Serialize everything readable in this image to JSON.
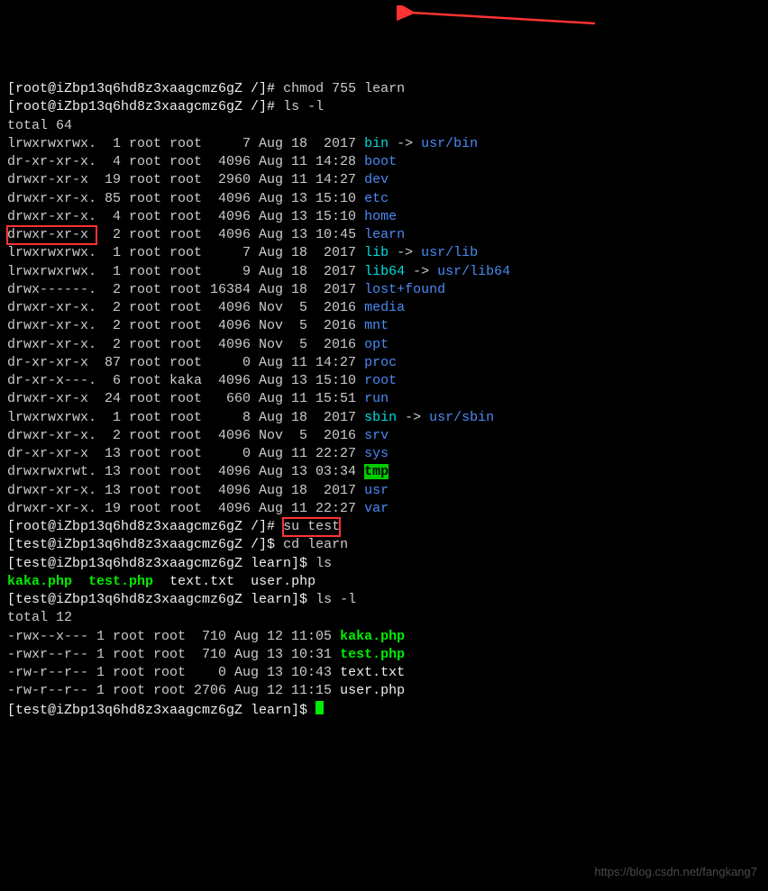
{
  "prompt_root": "[root@iZbp13q6hd8z3xaagcmz6gZ /]# ",
  "prompt_test": "[test@iZbp13q6hd8z3xaagcmz6gZ /]$ ",
  "prompt_test_learn": "[test@iZbp13q6hd8z3xaagcmz6gZ learn]$ ",
  "cmd_chmod": "chmod 755 learn",
  "cmd_lsl": "ls -l",
  "cmd_su": "su test",
  "cmd_cd": "cd learn",
  "cmd_ls": "ls",
  "total1": "total 64",
  "total2": "total 12",
  "arrow_link": " -> ",
  "files1": [
    {
      "perm": "lrwxrwxrwx.",
      "links": "1",
      "user": "root",
      "group": "root",
      "size": "7",
      "date": "Aug 18  2017",
      "name": "bin",
      "target": "usr/bin",
      "cls": "cyan"
    },
    {
      "perm": "dr-xr-xr-x.",
      "links": "4",
      "user": "root",
      "group": "root",
      "size": "4096",
      "date": "Aug 11 14:28",
      "name": "boot",
      "cls": "blue"
    },
    {
      "perm": "drwxr-xr-x ",
      "links": "19",
      "user": "root",
      "group": "root",
      "size": "2960",
      "date": "Aug 11 14:27",
      "name": "dev",
      "cls": "blue"
    },
    {
      "perm": "drwxr-xr-x.",
      "links": "85",
      "user": "root",
      "group": "root",
      "size": "4096",
      "date": "Aug 13 15:10",
      "name": "etc",
      "cls": "blue"
    },
    {
      "perm": "drwxr-xr-x.",
      "links": "4",
      "user": "root",
      "group": "root",
      "size": "4096",
      "date": "Aug 13 15:10",
      "name": "home",
      "cls": "blue"
    },
    {
      "perm": "drwxr-xr-x ",
      "links": "2",
      "user": "root",
      "group": "root",
      "size": "4096",
      "date": "Aug 13 10:45",
      "name": "learn",
      "cls": "blue",
      "boxperm": true
    },
    {
      "perm": "lrwxrwxrwx.",
      "links": "1",
      "user": "root",
      "group": "root",
      "size": "7",
      "date": "Aug 18  2017",
      "name": "lib",
      "target": "usr/lib",
      "cls": "cyan"
    },
    {
      "perm": "lrwxrwxrwx.",
      "links": "1",
      "user": "root",
      "group": "root",
      "size": "9",
      "date": "Aug 18  2017",
      "name": "lib64",
      "target": "usr/lib64",
      "cls": "cyan"
    },
    {
      "perm": "drwx------.",
      "links": "2",
      "user": "root",
      "group": "root",
      "size": "16384",
      "date": "Aug 18  2017",
      "name": "lost+found",
      "cls": "blue"
    },
    {
      "perm": "drwxr-xr-x.",
      "links": "2",
      "user": "root",
      "group": "root",
      "size": "4096",
      "date": "Nov  5  2016",
      "name": "media",
      "cls": "blue"
    },
    {
      "perm": "drwxr-xr-x.",
      "links": "2",
      "user": "root",
      "group": "root",
      "size": "4096",
      "date": "Nov  5  2016",
      "name": "mnt",
      "cls": "blue"
    },
    {
      "perm": "drwxr-xr-x.",
      "links": "2",
      "user": "root",
      "group": "root",
      "size": "4096",
      "date": "Nov  5  2016",
      "name": "opt",
      "cls": "blue"
    },
    {
      "perm": "dr-xr-xr-x ",
      "links": "87",
      "user": "root",
      "group": "root",
      "size": "0",
      "date": "Aug 11 14:27",
      "name": "proc",
      "cls": "blue"
    },
    {
      "perm": "dr-xr-x---.",
      "links": "6",
      "user": "root",
      "group": "kaka",
      "size": "4096",
      "date": "Aug 13 15:10",
      "name": "root",
      "cls": "blue"
    },
    {
      "perm": "drwxr-xr-x ",
      "links": "24",
      "user": "root",
      "group": "root",
      "size": "660",
      "date": "Aug 11 15:51",
      "name": "run",
      "cls": "blue"
    },
    {
      "perm": "lrwxrwxrwx.",
      "links": "1",
      "user": "root",
      "group": "root",
      "size": "8",
      "date": "Aug 18  2017",
      "name": "sbin",
      "target": "usr/sbin",
      "cls": "cyan"
    },
    {
      "perm": "drwxr-xr-x.",
      "links": "2",
      "user": "root",
      "group": "root",
      "size": "4096",
      "date": "Nov  5  2016",
      "name": "srv",
      "cls": "blue"
    },
    {
      "perm": "dr-xr-xr-x ",
      "links": "13",
      "user": "root",
      "group": "root",
      "size": "0",
      "date": "Aug 11 22:27",
      "name": "sys",
      "cls": "blue"
    },
    {
      "perm": "drwxrwxrwt.",
      "links": "13",
      "user": "root",
      "group": "root",
      "size": "4096",
      "date": "Aug 13 03:34",
      "name": "tmp",
      "cls": "tmphl"
    },
    {
      "perm": "drwxr-xr-x.",
      "links": "13",
      "user": "root",
      "group": "root",
      "size": "4096",
      "date": "Aug 18  2017",
      "name": "usr",
      "cls": "blue"
    },
    {
      "perm": "drwxr-xr-x.",
      "links": "19",
      "user": "root",
      "group": "root",
      "size": "4096",
      "date": "Aug 11 22:27",
      "name": "var",
      "cls": "blue"
    }
  ],
  "ls_learn": [
    {
      "name": "kaka.php",
      "cls": "green"
    },
    {
      "name": "test.php",
      "cls": "green"
    },
    {
      "name": "text.txt",
      "cls": "white"
    },
    {
      "name": "user.php",
      "cls": "white"
    }
  ],
  "files2": [
    {
      "perm": "-rwx--x---",
      "links": "1",
      "user": "root",
      "group": "root",
      "size": "710",
      "date": "Aug 12 11:05",
      "name": "kaka.php",
      "cls": "green"
    },
    {
      "perm": "-rwxr--r--",
      "links": "1",
      "user": "root",
      "group": "root",
      "size": "710",
      "date": "Aug 13 10:31",
      "name": "test.php",
      "cls": "green"
    },
    {
      "perm": "-rw-r--r--",
      "links": "1",
      "user": "root",
      "group": "root",
      "size": "0",
      "date": "Aug 13 10:43",
      "name": "text.txt",
      "cls": "white"
    },
    {
      "perm": "-rw-r--r--",
      "links": "1",
      "user": "root",
      "group": "root",
      "size": "2706",
      "date": "Aug 12 11:15",
      "name": "user.php",
      "cls": "white"
    }
  ],
  "watermark": "https://blog.csdn.net/fangkang7"
}
